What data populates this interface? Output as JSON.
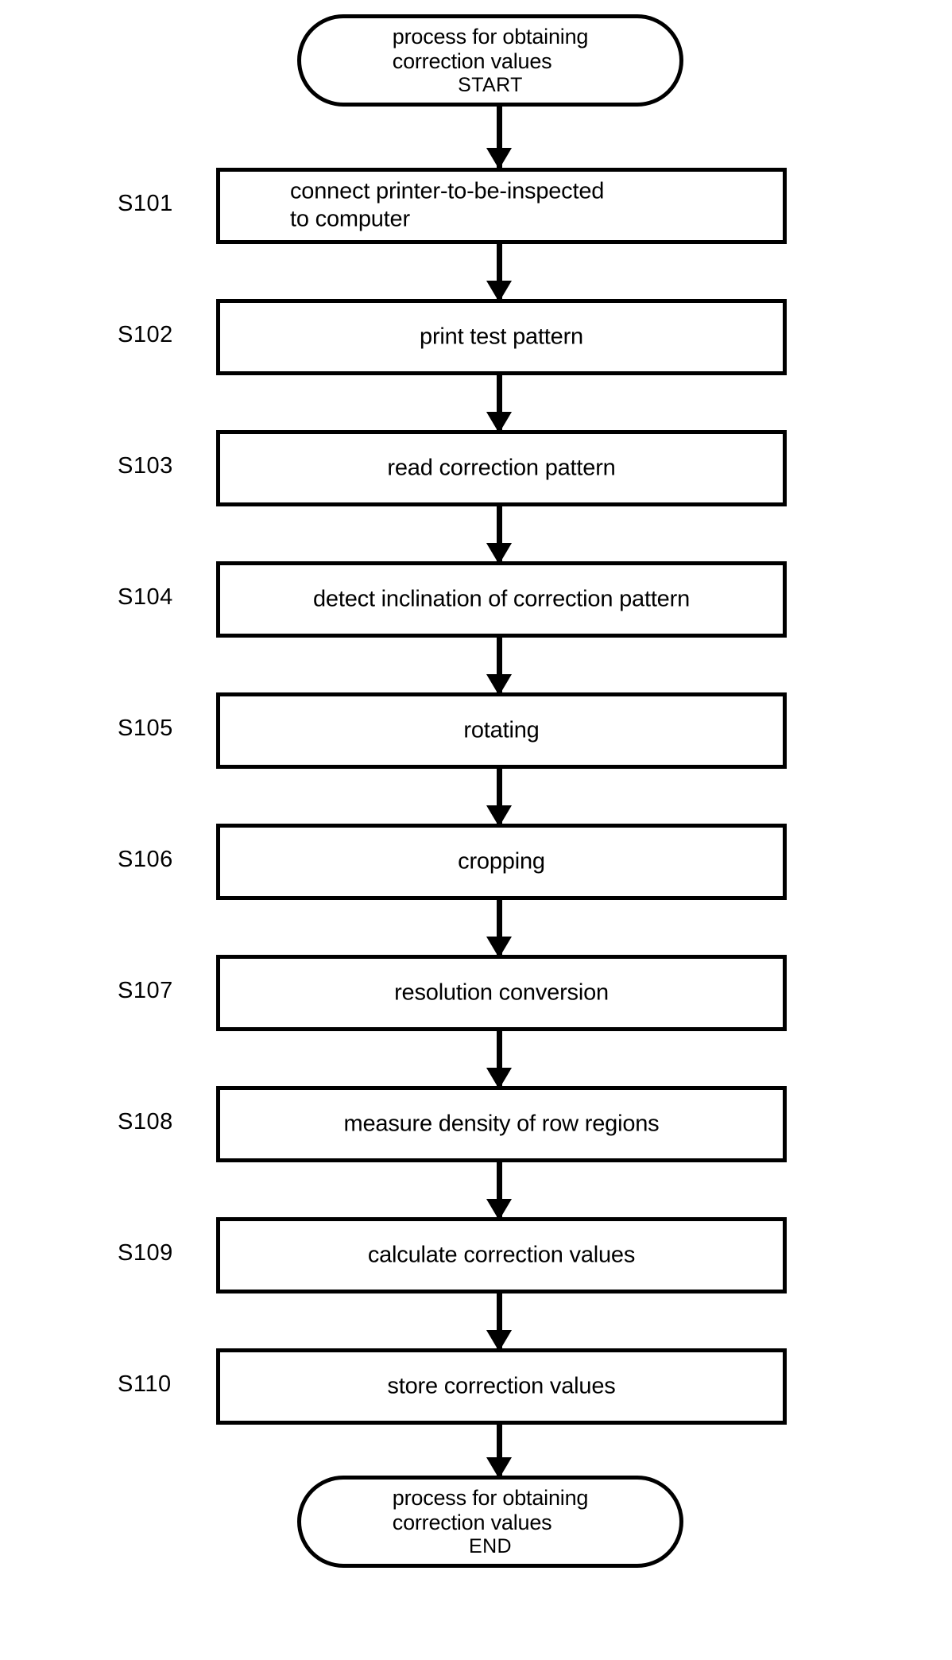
{
  "diagram": {
    "type": "flowchart",
    "orientation": "vertical",
    "title": "process for obtaining correction values"
  },
  "start": {
    "line1": "process for obtaining",
    "line2": "correction values",
    "state": "START"
  },
  "end": {
    "line1": "process for obtaining",
    "line2": "correction values",
    "state": "END"
  },
  "steps": [
    {
      "id": "S101",
      "text": "connect printer-to-be-inspected\nto computer",
      "align": "left"
    },
    {
      "id": "S102",
      "text": "print test pattern",
      "align": "center"
    },
    {
      "id": "S103",
      "text": "read correction pattern",
      "align": "center"
    },
    {
      "id": "S104",
      "text": "detect inclination of correction pattern",
      "align": "center"
    },
    {
      "id": "S105",
      "text": "rotating",
      "align": "center"
    },
    {
      "id": "S106",
      "text": "cropping",
      "align": "center"
    },
    {
      "id": "S107",
      "text": "resolution conversion",
      "align": "center"
    },
    {
      "id": "S108",
      "text": "measure density of row regions",
      "align": "center"
    },
    {
      "id": "S109",
      "text": "calculate correction values",
      "align": "center"
    },
    {
      "id": "S110",
      "text": "store correction values",
      "align": "center"
    }
  ],
  "colors": {
    "stroke": "#000000",
    "fill": "#ffffff",
    "text": "#000000"
  }
}
